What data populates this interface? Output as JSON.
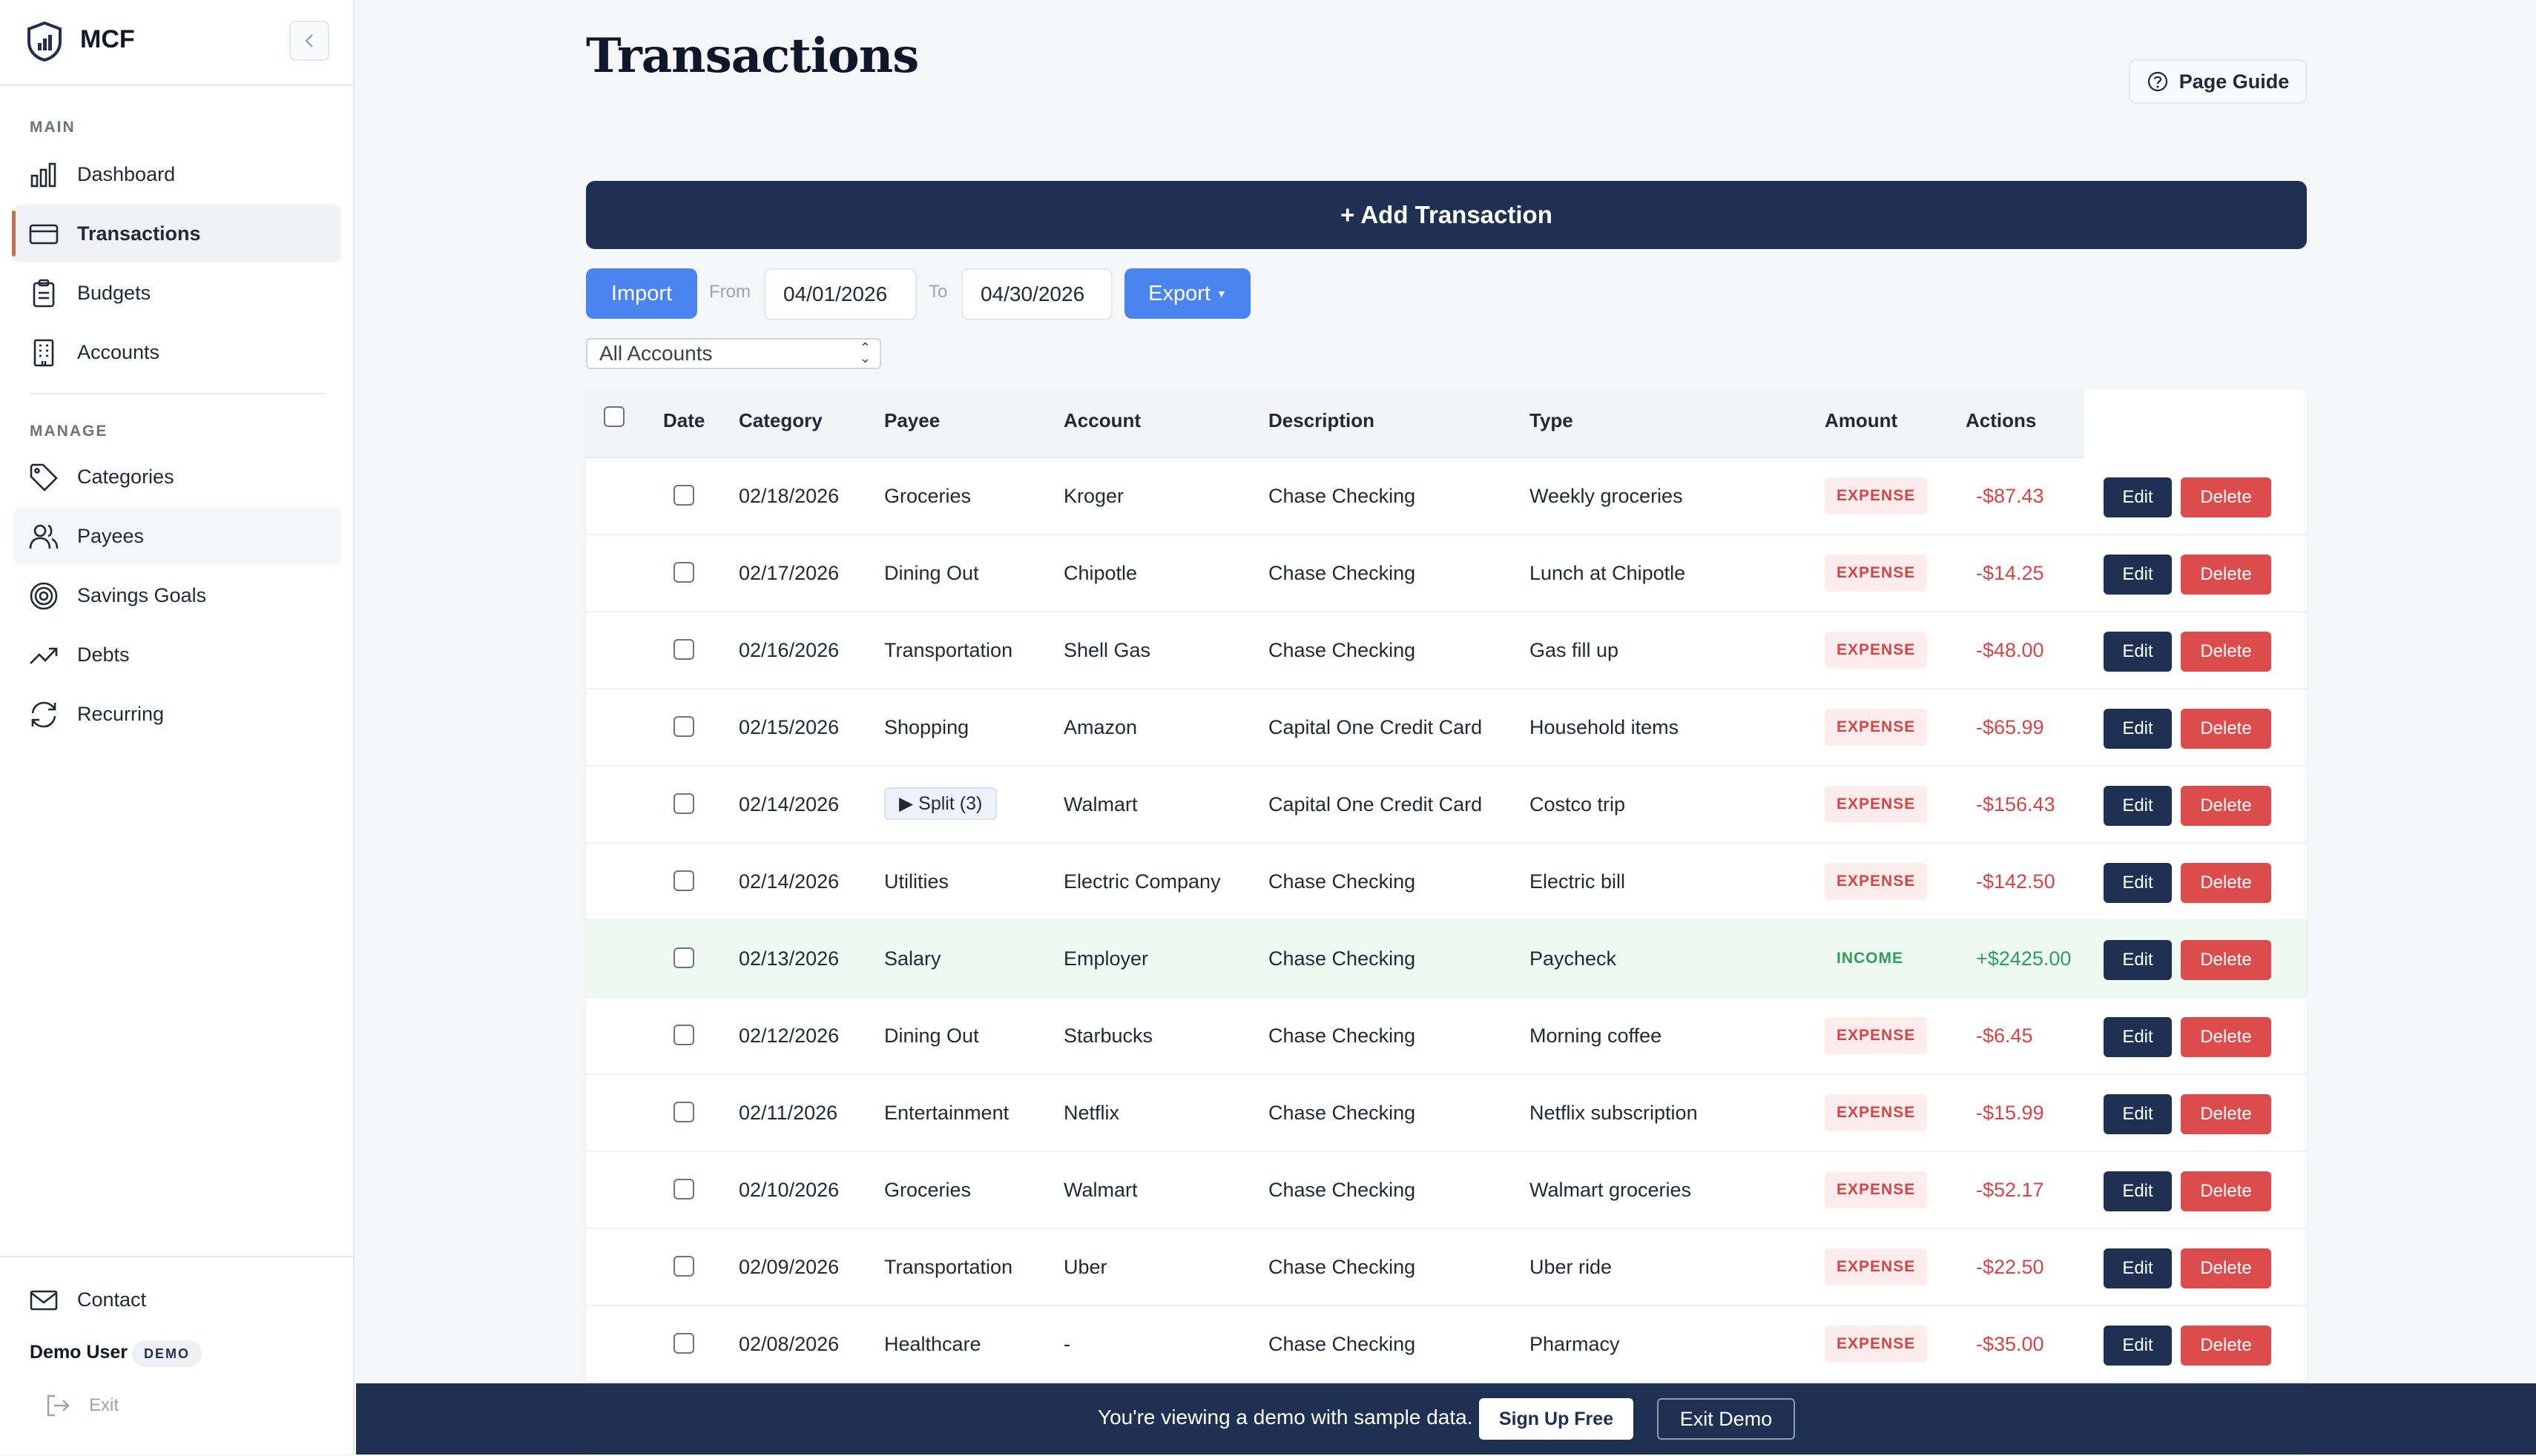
{
  "brand": {
    "name": "MCF"
  },
  "sidebar": {
    "main_label": "MAIN",
    "manage_label": "MANAGE",
    "main_items": [
      {
        "label": "Dashboard",
        "icon": "bar-chart-icon"
      },
      {
        "label": "Transactions",
        "icon": "credit-card-icon"
      },
      {
        "label": "Budgets",
        "icon": "clipboard-icon"
      },
      {
        "label": "Accounts",
        "icon": "building-icon"
      }
    ],
    "manage_items": [
      {
        "label": "Categories",
        "icon": "tag-icon"
      },
      {
        "label": "Payees",
        "icon": "users-icon"
      },
      {
        "label": "Savings Goals",
        "icon": "target-icon"
      },
      {
        "label": "Debts",
        "icon": "trending-up-icon"
      },
      {
        "label": "Recurring",
        "icon": "refresh-icon"
      }
    ],
    "contact": "Contact",
    "user": "Demo User",
    "user_badge": "DEMO",
    "exit": "Exit"
  },
  "header": {
    "title": "Transactions",
    "guide": "Page Guide"
  },
  "toolbar": {
    "add": "+ Add Transaction",
    "import": "Import",
    "from_label": "From",
    "from_value": "04/01/2026",
    "to_label": "To",
    "to_value": "04/30/2026",
    "export": "Export",
    "account_filter": "All Accounts"
  },
  "table": {
    "headers": [
      "Date",
      "Category",
      "Payee",
      "Account",
      "Description",
      "Type",
      "Amount",
      "Actions"
    ],
    "edit_label": "Edit",
    "delete_label": "Delete",
    "rows": [
      {
        "date": "02/18/2026",
        "category": "Groceries",
        "payee": "Kroger",
        "account": "Chase Checking",
        "description": "Weekly groceries",
        "type": "EXPENSE",
        "amount": "-$87.43"
      },
      {
        "date": "02/17/2026",
        "category": "Dining Out",
        "payee": "Chipotle",
        "account": "Chase Checking",
        "description": "Lunch at Chipotle",
        "type": "EXPENSE",
        "amount": "-$14.25"
      },
      {
        "date": "02/16/2026",
        "category": "Transportation",
        "payee": "Shell Gas",
        "account": "Chase Checking",
        "description": "Gas fill up",
        "type": "EXPENSE",
        "amount": "-$48.00"
      },
      {
        "date": "02/15/2026",
        "category": "Shopping",
        "payee": "Amazon",
        "account": "Capital One Credit Card",
        "description": "Household items",
        "type": "EXPENSE",
        "amount": "-$65.99"
      },
      {
        "date": "02/14/2026",
        "category": "▶ Split (3)",
        "payee": "Walmart",
        "account": "Capital One Credit Card",
        "description": "Costco trip",
        "type": "EXPENSE",
        "amount": "-$156.43"
      },
      {
        "date": "02/14/2026",
        "category": "Utilities",
        "payee": "Electric Company",
        "account": "Chase Checking",
        "description": "Electric bill",
        "type": "EXPENSE",
        "amount": "-$142.50"
      },
      {
        "date": "02/13/2026",
        "category": "Salary",
        "payee": "Employer",
        "account": "Chase Checking",
        "description": "Paycheck",
        "type": "INCOME",
        "amount": "+$2425.00"
      },
      {
        "date": "02/12/2026",
        "category": "Dining Out",
        "payee": "Starbucks",
        "account": "Chase Checking",
        "description": "Morning coffee",
        "type": "EXPENSE",
        "amount": "-$6.45"
      },
      {
        "date": "02/11/2026",
        "category": "Entertainment",
        "payee": "Netflix",
        "account": "Chase Checking",
        "description": "Netflix subscription",
        "type": "EXPENSE",
        "amount": "-$15.99"
      },
      {
        "date": "02/10/2026",
        "category": "Groceries",
        "payee": "Walmart",
        "account": "Chase Checking",
        "description": "Walmart groceries",
        "type": "EXPENSE",
        "amount": "-$52.17"
      },
      {
        "date": "02/09/2026",
        "category": "Transportation",
        "payee": "Uber",
        "account": "Chase Checking",
        "description": "Uber ride",
        "type": "EXPENSE",
        "amount": "-$22.50"
      },
      {
        "date": "02/08/2026",
        "category": "Healthcare",
        "payee": "-",
        "account": "Chase Checking",
        "description": "Pharmacy",
        "type": "EXPENSE",
        "amount": "-$35.00"
      }
    ]
  },
  "banner": {
    "text": "You're viewing a demo with sample data.",
    "signup": "Sign Up Free",
    "exit": "Exit Demo"
  },
  "colors": {
    "navy": "#1e3152",
    "blue": "#4b84ee",
    "red": "#dc4c4c",
    "green": "#2f9e5b",
    "accent": "#c2714f"
  }
}
